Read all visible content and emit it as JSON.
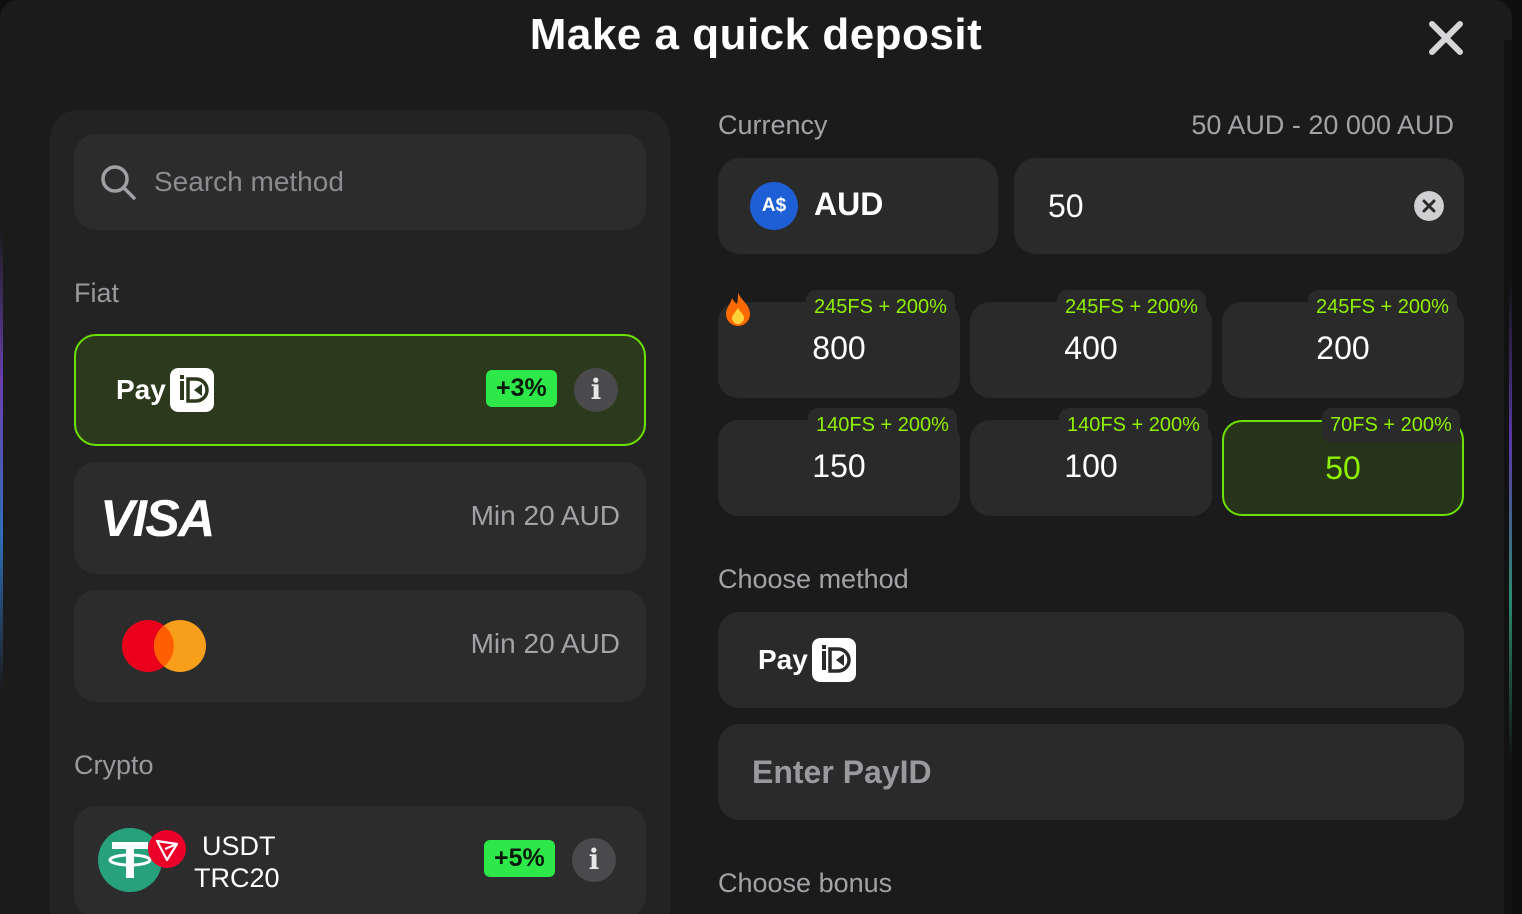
{
  "header": {
    "title": "Make a quick deposit"
  },
  "search": {
    "placeholder": "Search method"
  },
  "sections": {
    "fiat": "Fiat",
    "crypto": "Crypto"
  },
  "methods": [
    {
      "name": "PayID",
      "pay_text": "Pay",
      "badge": "+3%",
      "info": "i",
      "selected": true
    },
    {
      "name": "Visa",
      "logo_text": "VISA",
      "min": "Min 20 AUD"
    },
    {
      "name": "Mastercard",
      "min": "Min 20 AUD"
    },
    {
      "name": "USDT TRC20",
      "line1": "USDT",
      "line2": "TRC20",
      "badge": "+5%",
      "info": "i"
    }
  ],
  "currency": {
    "label": "Currency",
    "range": "50 AUD - 20 000 AUD",
    "symbol": "A$",
    "code": "AUD",
    "amount": "50"
  },
  "presets": [
    {
      "bonus": "245FS + 200%",
      "amount": "800",
      "hot": true
    },
    {
      "bonus": "245FS + 200%",
      "amount": "400"
    },
    {
      "bonus": "245FS + 200%",
      "amount": "200"
    },
    {
      "bonus": "140FS + 200%",
      "amount": "150"
    },
    {
      "bonus": "140FS + 200%",
      "amount": "100"
    },
    {
      "bonus": "70FS + 200%",
      "amount": "50",
      "selected": true
    }
  ],
  "choose_method": {
    "label": "Choose method",
    "pay_text": "Pay",
    "placeholder": "Enter PayID"
  },
  "choose_bonus": {
    "label": "Choose bonus"
  },
  "colors": {
    "accent": "#6ce000",
    "badge": "#2ee84a",
    "bg": "#1b1b1c",
    "card": "#2a2a2b"
  },
  "icons": [
    "close-icon",
    "search-icon",
    "payid-logo-icon",
    "visa-logo",
    "mastercard-logo",
    "tether-icon",
    "tron-icon",
    "info-icon",
    "clear-icon",
    "fire-icon"
  ]
}
